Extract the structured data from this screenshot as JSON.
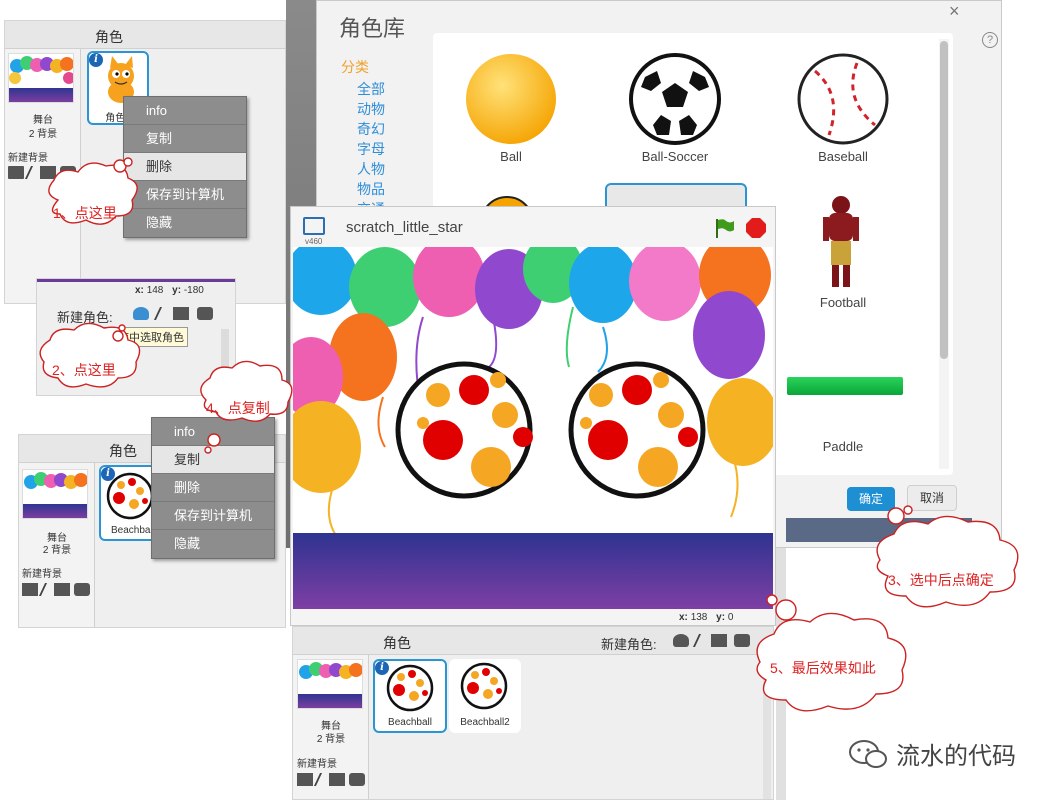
{
  "panel1": {
    "header": "角色",
    "stage_label": "舞台",
    "stage_count": "2 背景",
    "new_backdrop": "新建背景",
    "sprite_name": "角色1",
    "info_badge": "i"
  },
  "menu1": {
    "items": [
      "info",
      "复制",
      "删除",
      "保存到计算机",
      "隐藏"
    ],
    "highlighted": 2
  },
  "panel2": {
    "coords_x_label": "x:",
    "coords_x": "148",
    "coords_y_label": "y:",
    "coords_y": "-180",
    "new_sprite_label": "新建角色:",
    "tooltip": "从角色库中选取角色"
  },
  "panel3": {
    "header": "角色",
    "stage_label": "舞台",
    "stage_count": "2 背景",
    "new_backdrop": "新建背景",
    "sprite_name": "Beachball",
    "info_badge": "i"
  },
  "menu3": {
    "items": [
      "info",
      "复制",
      "删除",
      "保存到计算机",
      "隐藏"
    ],
    "highlighted": 1
  },
  "library": {
    "title": "角色库",
    "category_header": "分类",
    "categories": [
      "全部",
      "动物",
      "奇幻",
      "字母",
      "人物",
      "物品",
      "交通"
    ],
    "items": [
      "Ball",
      "Ball-Soccer",
      "Baseball",
      "Football",
      "Paddle"
    ],
    "ok": "确定",
    "cancel": "取消",
    "close": "×",
    "help": "?"
  },
  "stage": {
    "title": "scratch_little_star",
    "version": "v460",
    "coords_x_label": "x:",
    "coords_x": "138",
    "coords_y_label": "y:",
    "coords_y": "0"
  },
  "panel4": {
    "header": "角色",
    "new_sprite_label": "新建角色:",
    "stage_label": "舞台",
    "stage_count": "2 背景",
    "new_backdrop": "新建背景",
    "sprites": [
      "Beachball",
      "Beachball2"
    ],
    "info_badge": "i"
  },
  "annotations": [
    "1、点这里",
    "2、点这里",
    "3、选中后点确定",
    "4、点复制",
    "5、最后效果如此"
  ],
  "watermark": "流水的代码",
  "colors": {
    "accent": "#2b95d3",
    "annotation": "#dd2222",
    "menu": "#8d8d8d",
    "ok_button": "#1e8fd3"
  }
}
